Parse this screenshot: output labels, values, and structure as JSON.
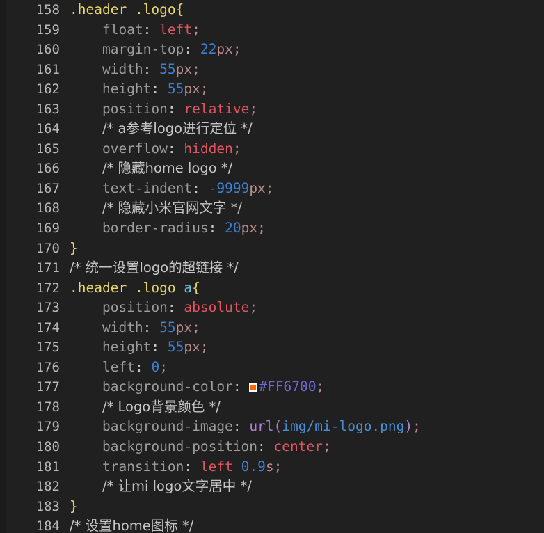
{
  "editor": {
    "theme": {
      "background": "#202020",
      "gutter_text": "#b9b9b9",
      "selector": "#e8d66a",
      "element_selector": "#6fc3df",
      "property": "#9d9d9d",
      "value_keyword": "#e05561",
      "number": "#3f7fd0",
      "comment": "#c6c6c6",
      "function": "#b07fd0",
      "string": "#4a8fd6",
      "hex_color": "#6a6ad6",
      "indent_guide": "#4a4a42"
    },
    "language": "css",
    "first_line_number": 158,
    "last_line_number": 184,
    "color_swatch": {
      "value": "#FF6700",
      "fill": "#ff6700",
      "border": "#ffffff"
    },
    "lines": [
      {
        "n": "158",
        "text": ".header .logo{"
      },
      {
        "n": "159",
        "text": "    float: left;"
      },
      {
        "n": "160",
        "text": "    margin-top: 22px;"
      },
      {
        "n": "161",
        "text": "    width: 55px;"
      },
      {
        "n": "162",
        "text": "    height: 55px;"
      },
      {
        "n": "163",
        "text": "    position: relative;"
      },
      {
        "n": "164",
        "text": "    /* a参考logo进行定位 */"
      },
      {
        "n": "165",
        "text": "    overflow: hidden;"
      },
      {
        "n": "166",
        "text": "    /* 隐藏home logo */"
      },
      {
        "n": "167",
        "text": "    text-indent: -9999px;"
      },
      {
        "n": "168",
        "text": "    /* 隐藏小米官网文字 */"
      },
      {
        "n": "169",
        "text": "    border-radius: 20px;"
      },
      {
        "n": "170",
        "text": "}"
      },
      {
        "n": "171",
        "text": "/* 统一设置logo的超链接 */"
      },
      {
        "n": "172",
        "text": ".header .logo a{"
      },
      {
        "n": "173",
        "text": "    position: absolute;"
      },
      {
        "n": "174",
        "text": "    width: 55px;"
      },
      {
        "n": "175",
        "text": "    height: 55px;"
      },
      {
        "n": "176",
        "text": "    left: 0;"
      },
      {
        "n": "177",
        "text": "    background-color: #FF6700;"
      },
      {
        "n": "178",
        "text": "    /* Logo背景颜色 */"
      },
      {
        "n": "179",
        "text": "    background-image: url(img/mi-logo.png);"
      },
      {
        "n": "180",
        "text": "    background-position: center;"
      },
      {
        "n": "181",
        "text": "    transition: left 0.9s;"
      },
      {
        "n": "182",
        "text": "    /* 让mi logo文字居中 */"
      },
      {
        "n": "183",
        "text": "}"
      },
      {
        "n": "184",
        "text": "/* 设置home图标 */"
      }
    ],
    "tokens": {
      "l158": {
        "sel1": ".header",
        "sel2": ".logo",
        "brace": "{"
      },
      "l159": {
        "prop": "float",
        "colon": ":",
        "value": "left",
        "semi": ";"
      },
      "l160": {
        "prop": "margin-top",
        "colon": ":",
        "num": "22",
        "unit": "px",
        "semi": ";"
      },
      "l161": {
        "prop": "width",
        "colon": ":",
        "num": "55",
        "unit": "px",
        "semi": ";"
      },
      "l162": {
        "prop": "height",
        "colon": ":",
        "num": "55",
        "unit": "px",
        "semi": ";"
      },
      "l163": {
        "prop": "position",
        "colon": ":",
        "value": "relative",
        "semi": ";"
      },
      "l164": {
        "comment": "/* a参考logo进行定位 */"
      },
      "l165": {
        "prop": "overflow",
        "colon": ":",
        "value": "hidden",
        "semi": ";"
      },
      "l166": {
        "comment": "/* 隐藏home logo */"
      },
      "l167": {
        "prop": "text-indent",
        "colon": ":",
        "num": "-9999",
        "unit": "px",
        "semi": ";"
      },
      "l168": {
        "comment": "/* 隐藏小米官网文字 */"
      },
      "l169": {
        "prop": "border-radius",
        "colon": ":",
        "num": "20",
        "unit": "px",
        "semi": ";"
      },
      "l170": {
        "brace": "}"
      },
      "l171": {
        "comment": "/* 统一设置logo的超链接 */"
      },
      "l172": {
        "sel1": ".header",
        "sel2": ".logo",
        "elem": "a",
        "brace": "{"
      },
      "l173": {
        "prop": "position",
        "colon": ":",
        "value": "absolute",
        "semi": ";"
      },
      "l174": {
        "prop": "width",
        "colon": ":",
        "num": "55",
        "unit": "px",
        "semi": ";"
      },
      "l175": {
        "prop": "height",
        "colon": ":",
        "num": "55",
        "unit": "px",
        "semi": ";"
      },
      "l176": {
        "prop": "left",
        "colon": ":",
        "num": "0",
        "semi": ";"
      },
      "l177": {
        "prop": "background-color",
        "colon": ":",
        "hex": "#FF6700",
        "semi": ";"
      },
      "l178": {
        "comment": "/* Logo背景颜色 */"
      },
      "l179": {
        "prop": "background-image",
        "colon": ":",
        "func": "url",
        "paren_open": "(",
        "string": "img/mi-logo.png",
        "paren_close": ")",
        "semi": ";"
      },
      "l180": {
        "prop": "background-position",
        "colon": ":",
        "value": "center",
        "semi": ";"
      },
      "l181": {
        "prop": "transition",
        "colon": ":",
        "value": "left",
        "num": "0.9",
        "unit": "s",
        "semi": ";"
      },
      "l182": {
        "comment": "/* 让mi logo文字居中 */"
      },
      "l183": {
        "brace": "}"
      },
      "l184": {
        "comment": "/* 设置home图标 */"
      }
    }
  }
}
